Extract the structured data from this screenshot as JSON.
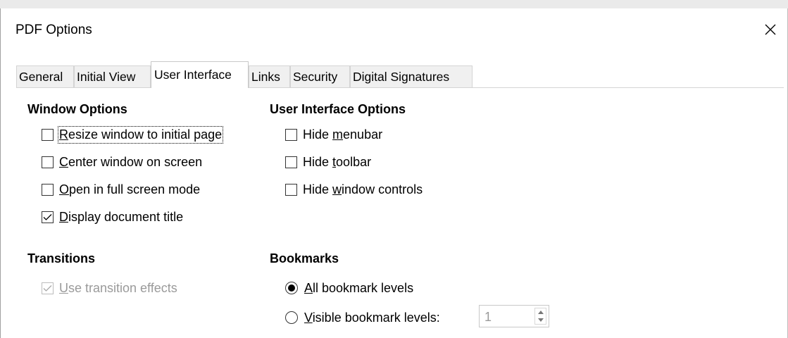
{
  "dialog": {
    "title": "PDF Options"
  },
  "tabs": [
    {
      "label": "General"
    },
    {
      "label": "Initial View"
    },
    {
      "label": "User Interface",
      "active": true
    },
    {
      "label": "Links"
    },
    {
      "label": "Security"
    },
    {
      "label": "Digital Signatures"
    }
  ],
  "window_options": {
    "title": "Window Options",
    "items": [
      {
        "accel": "R",
        "rest": "esize window to initial page",
        "checked": false
      },
      {
        "accel": "C",
        "rest": "enter window on screen",
        "checked": false
      },
      {
        "accel": "O",
        "rest": "pen in full screen mode",
        "checked": false
      },
      {
        "accel": "D",
        "rest": "isplay document title",
        "checked": true
      }
    ]
  },
  "ui_options": {
    "title": "User Interface Options",
    "items": [
      {
        "pre": "Hide ",
        "accel": "m",
        "rest": "enubar",
        "checked": false
      },
      {
        "pre": "Hide ",
        "accel": "t",
        "rest": "oolbar",
        "checked": false
      },
      {
        "pre": "Hide ",
        "accel": "w",
        "rest": "indow controls",
        "checked": false
      }
    ]
  },
  "transitions": {
    "title": "Transitions",
    "use_effects": {
      "accel": "U",
      "rest": "se transition effects",
      "checked": true,
      "disabled": true
    }
  },
  "bookmarks": {
    "title": "Bookmarks",
    "all": {
      "accel": "A",
      "rest": "ll bookmark levels",
      "selected": true
    },
    "visible": {
      "accel": "V",
      "rest": "isible bookmark levels:",
      "selected": false
    },
    "levels_value": "1"
  },
  "colors": {
    "disabled_text": "#9a9a9a",
    "tab_bg": "#f0f0f0"
  }
}
